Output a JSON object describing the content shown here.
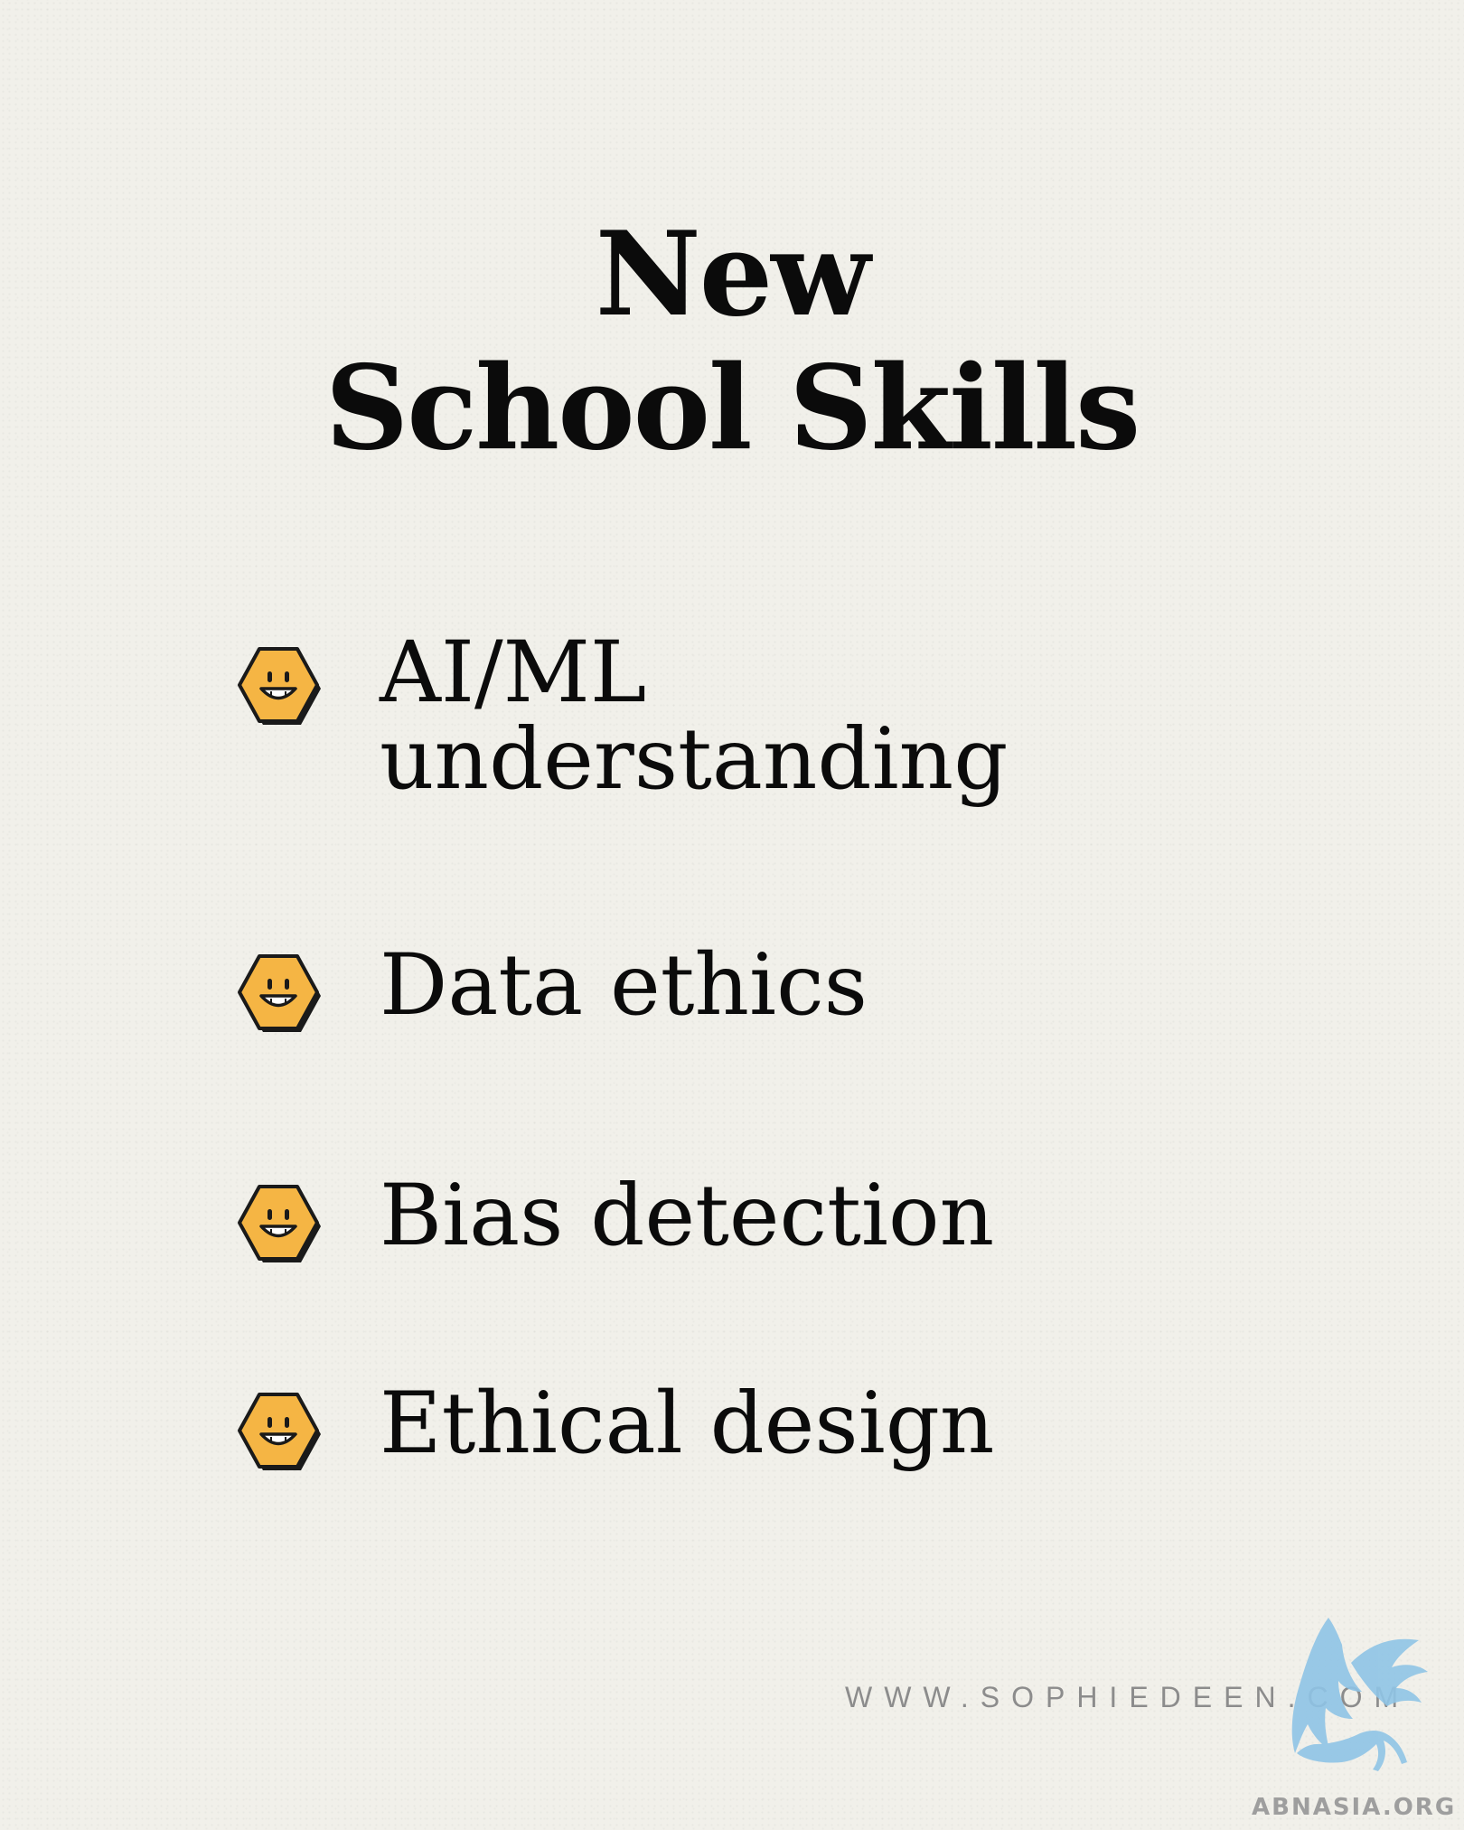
{
  "title": {
    "line1": "New",
    "line2": "School Skills"
  },
  "skills": [
    {
      "line1": "AI/ML",
      "line2": "understanding",
      "icon": "hexagon-smiley-icon"
    },
    {
      "line1": "Data ethics",
      "icon": "hexagon-smiley-icon"
    },
    {
      "line1": "Bias detection",
      "icon": "hexagon-smiley-icon"
    },
    {
      "line1": "Ethical design",
      "icon": "hexagon-smiley-icon"
    }
  ],
  "footer": {
    "website": "WWW.SOPHIEDEEN.COM"
  },
  "watermark": {
    "text": "ABNASIA.ORG",
    "icon": "griffin-logo-icon"
  },
  "colors": {
    "background": "#f1f0ea",
    "text": "#0b0b0b",
    "icon_fill": "#f5b544",
    "icon_outline": "#1a1a1a",
    "watermark": "#8fc4e6"
  }
}
